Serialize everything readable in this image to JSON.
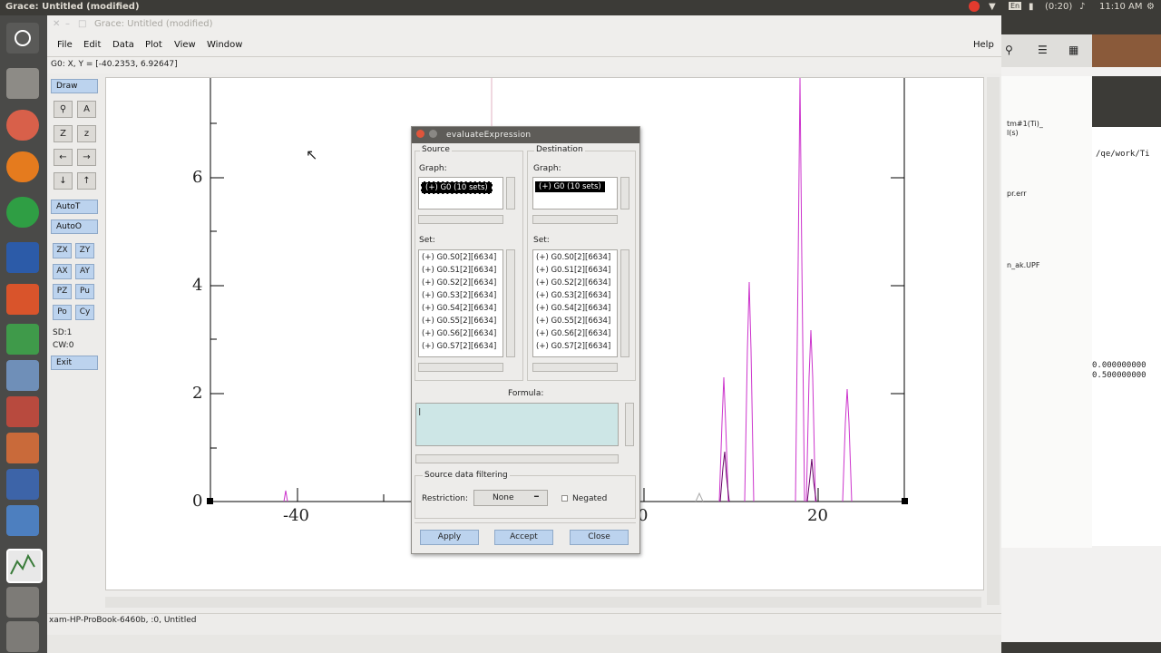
{
  "system": {
    "window_title": "Grace: Untitled (modified)",
    "battery": "(0:20)",
    "keyboard": "En",
    "clock": "11:10 AM"
  },
  "grace": {
    "title": "Grace: Untitled (modified)",
    "menu": [
      "File",
      "Edit",
      "Data",
      "Plot",
      "View",
      "Window"
    ],
    "help": "Help",
    "coords": "G0: X, Y = [-40.2353, 6.92647]",
    "tools": {
      "draw": "Draw",
      "autot": "AutoT",
      "autoo": "AutoO",
      "zx": "ZX",
      "zy": "ZY",
      "ax": "AX",
      "ay": "AY",
      "pz": "PZ",
      "pu": "Pu",
      "po": "Po",
      "cy": "Cy",
      "sd": "SD:1",
      "cw": "CW:0",
      "exit": "Exit"
    },
    "status": "xam-HP-ProBook-6460b, :0, Untitled"
  },
  "plot": {
    "y_ticks": [
      "0",
      "2",
      "4",
      "6"
    ],
    "x_ticks": [
      "-40",
      "0",
      "20"
    ]
  },
  "dialog": {
    "title": "evaluateExpression",
    "source_label": "Source",
    "destination_label": "Destination",
    "graph_label": "Graph:",
    "graph_item": "(+) G0 (10 sets)",
    "set_label": "Set:",
    "sets": [
      "(+) G0.S0[2][6634]",
      "(+) G0.S1[2][6634]",
      "(+) G0.S2[2][6634]",
      "(+) G0.S3[2][6634]",
      "(+) G0.S4[2][6634]",
      "(+) G0.S5[2][6634]",
      "(+) G0.S6[2][6634]",
      "(+) G0.S7[2][6634]"
    ],
    "formula_label": "Formula:",
    "formula_value": "",
    "filter_label": "Source data filtering",
    "restriction_label": "Restriction:",
    "restriction_value": "None",
    "negated_label": "Negated",
    "apply": "Apply",
    "accept": "Accept",
    "close": "Close"
  },
  "background_window": {
    "lines": [
      "tm#1(Ti)_",
      "l(s)",
      "/qe/work/Ti",
      "pr.err",
      "n_ak.UPF",
      "0.000000000",
      "0.500000000"
    ]
  }
}
